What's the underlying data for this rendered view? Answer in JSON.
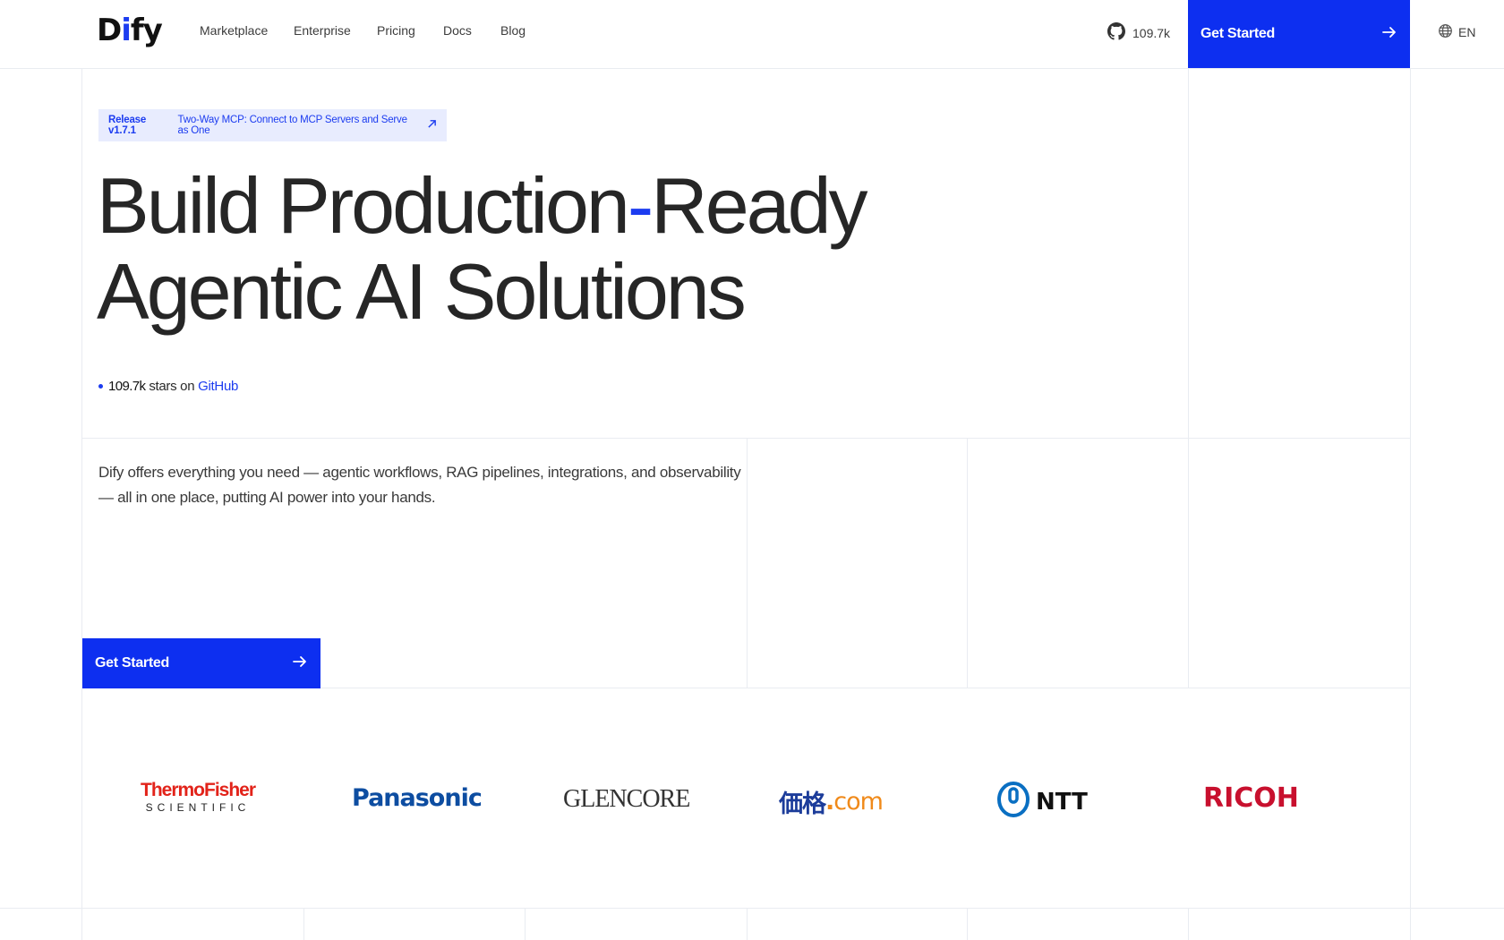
{
  "header": {
    "logo_text": "Dify",
    "nav": [
      {
        "label": "Marketplace"
      },
      {
        "label": "Enterprise"
      },
      {
        "label": "Pricing"
      },
      {
        "label": "Docs"
      },
      {
        "label": "Blog"
      }
    ],
    "github_stars": "109.7k",
    "cta_label": "Get Started",
    "language": "EN"
  },
  "hero": {
    "release_version": "Release v1.7.1",
    "release_text": "Two-Way MCP: Connect to MCP Servers and Serve as One",
    "title_line1_a": "Build Production",
    "title_hyphen": "-",
    "title_line1_b": "Ready",
    "title_line2": "Agentic AI Solutions",
    "stars_count": "109.7k",
    "stars_mid": "stars on",
    "stars_link": "GitHub",
    "description": "Dify offers everything you need — agentic workflows, RAG pipelines, integrations, and observability — all in one place, putting AI power into your hands.",
    "cta_label": "Get Started"
  },
  "logos": {
    "thermo_line1": "ThermoFisher",
    "thermo_line2": "SCIENTIFIC",
    "panasonic": "Panasonic",
    "glencore": "GLENCORE",
    "kakaku_kanji": "価格",
    "kakaku_dot": ".",
    "kakaku_com": "com",
    "ntt": "NTT",
    "ricoh": "RICOH"
  },
  "colors": {
    "accent": "#0d2ff0",
    "badge_bg": "#e8ecfe",
    "gridline": "#e9ecf1"
  }
}
